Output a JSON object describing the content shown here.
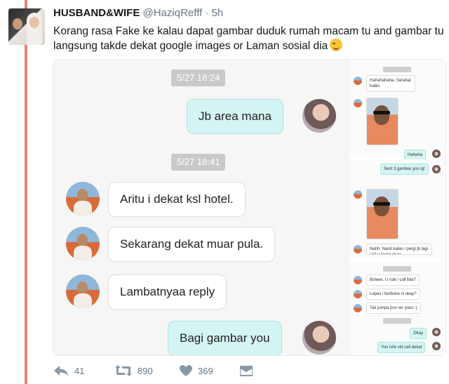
{
  "tweet": {
    "display_name": "HUSBAND&WIFE",
    "handle": "@HaziqRefff",
    "separator": "·",
    "time": "5h",
    "text": "Korang rasa Fake ke kalau dapat gambar duduk rumah macam tu and gambar tu langsung takde dekat google images or Laman sosial dia"
  },
  "chat": {
    "timestamps": [
      "5/27 18:24",
      "5/27 18:41"
    ],
    "messages": [
      {
        "direction": "outgoing",
        "text": "Jb area mana"
      },
      {
        "direction": "incoming",
        "text": "Aritu i dekat ksl hotel."
      },
      {
        "direction": "incoming",
        "text": "Sekarang dekat muar pula."
      },
      {
        "direction": "incoming",
        "text": "Lambatnyaa reply"
      },
      {
        "direction": "outgoing",
        "text": "Bagi gambar you"
      }
    ]
  },
  "mini_chat": {
    "messages": [
      "Hahahahaha. Serabai habis",
      "Hahaha",
      "Sent 3 gambar you lg!",
      "Nahh. Nanti kalau i pergi jb lagi i let u know okay",
      "Boleee. U nak i call bila?",
      "Lepas i berbuka ni okay?",
      "Tak jumpa pun wc youu :(",
      "Okay",
      "You nAk vid call dekat"
    ]
  },
  "actions": {
    "replies": "41",
    "retweets": "890",
    "likes": "369"
  },
  "colors": {
    "thread_rail": "#e8846a",
    "outgoing_bubble": "#d4f5f3",
    "timestamp_bg": "#c9c9c9"
  }
}
